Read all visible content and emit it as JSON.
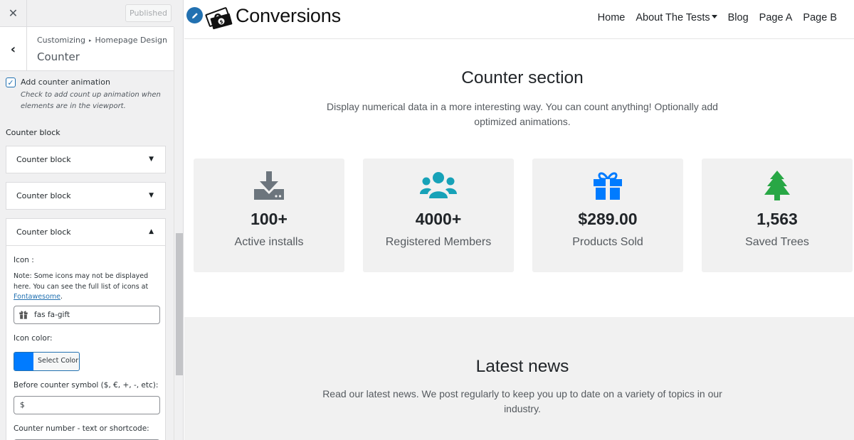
{
  "customizer": {
    "close_label": "✕",
    "publish_label": "Published",
    "back_label": "‹",
    "breadcrumb": [
      "Customizing",
      "Homepage Design"
    ],
    "breadcrumb_separator": "▸",
    "section_title": "Counter",
    "animation_option": {
      "checked": true,
      "label": "Add counter animation",
      "description": "Check to add count up animation when elements are in the viewport."
    },
    "counter_blocks_heading": "Counter block",
    "accordions": [
      {
        "label": "Counter block",
        "expanded": false,
        "arrow": "▼"
      },
      {
        "label": "Counter block",
        "expanded": false,
        "arrow": "▼"
      },
      {
        "label": "Counter block",
        "expanded": true,
        "arrow": "▲"
      }
    ],
    "expanded_block": {
      "icon_label": "Icon :",
      "icon_note": "Note: Some icons may not be displayed here. You can see the full list of icons at",
      "icon_note_link": "Fontawesome",
      "icon_note_end": ".",
      "icon_value": "fas fa-gift",
      "icon_color_label": "Icon color:",
      "icon_color": "#007bff",
      "select_color_label": "Select Color",
      "before_symbol_label": "Before counter symbol ($, €, +, -, etc):",
      "before_symbol_value": "$",
      "counter_number_label": "Counter number - text or shortcode:"
    }
  },
  "preview": {
    "brand": "Conversions",
    "nav": [
      "Home",
      "About The Tests",
      "Blog",
      "Page A",
      "Page B"
    ],
    "counter_section": {
      "title": "Counter section",
      "description": "Display numerical data in a more interesting way. You can count anything! Optionally add optimized animations.",
      "counters": [
        {
          "icon": "download-icon",
          "icon_color": "#6c757d",
          "number": "100+",
          "label": "Active installs"
        },
        {
          "icon": "users-icon",
          "icon_color": "#17a2b8",
          "number": "4000+",
          "label": "Registered Members"
        },
        {
          "icon": "gift-icon",
          "icon_color": "#007bff",
          "number": "$289.00",
          "label": "Products Sold"
        },
        {
          "icon": "tree-icon",
          "icon_color": "#28a745",
          "number": "1,563",
          "label": "Saved Trees"
        }
      ]
    },
    "news_section": {
      "title": "Latest news",
      "description": "Read our latest news. We post regularly to keep you up to date on a variety of topics in our industry."
    }
  }
}
